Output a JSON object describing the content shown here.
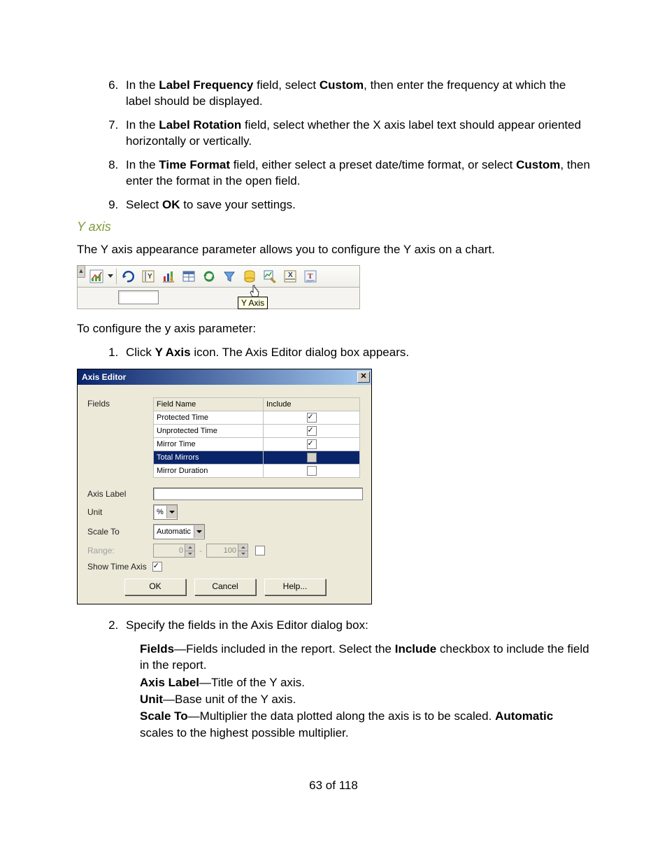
{
  "steps_top": [
    {
      "n": 6,
      "pre": "In the ",
      "b1": "Label Frequency",
      "mid": " field, select ",
      "b2": "Custom",
      "post": ", then enter the frequency at which the label should be displayed."
    },
    {
      "n": 7,
      "pre": "In the ",
      "b1": "Label Rotation",
      "mid": " field, select whether the X axis label text should appear oriented horizontally or vertically.",
      "b2": "",
      "post": ""
    },
    {
      "n": 8,
      "pre": "In the ",
      "b1": "Time Format",
      "mid": " field, either select a preset date/time format, or select ",
      "b2": "Custom",
      "post": ", then enter the format in the open field."
    },
    {
      "n": 9,
      "pre": "Select ",
      "b1": "OK",
      "mid": " to save your settings.",
      "b2": "",
      "post": ""
    }
  ],
  "heading_yaxis": "Y axis",
  "para_yaxis_intro": "The Y axis appearance parameter allows you to configure the Y axis on a chart.",
  "toolbar": {
    "tooltip": "Y Axis"
  },
  "para_configure": "To configure the y axis parameter:",
  "step1": {
    "pre": "Click ",
    "b": "Y Axis",
    "post": " icon. The Axis Editor dialog box appears."
  },
  "dialog": {
    "title": "Axis Editor",
    "fields_label": "Fields",
    "col_fieldname": "Field Name",
    "col_include": "Include",
    "rows": [
      {
        "name": "Protected Time",
        "checked": true,
        "disabled": false,
        "selected": false
      },
      {
        "name": "Unprotected Time",
        "checked": true,
        "disabled": false,
        "selected": false
      },
      {
        "name": "Mirror Time",
        "checked": true,
        "disabled": false,
        "selected": false
      },
      {
        "name": "Total Mirrors",
        "checked": false,
        "disabled": true,
        "selected": true
      },
      {
        "name": "Mirror Duration",
        "checked": false,
        "disabled": false,
        "selected": false
      }
    ],
    "axis_label_lbl": "Axis Label",
    "unit_lbl": "Unit",
    "unit_value": "%",
    "scaleto_lbl": "Scale To",
    "scaleto_value": "Automatic",
    "range_lbl": "Range:",
    "range_low": "0",
    "range_high": "100",
    "show_time_lbl": "Show Time Axis",
    "show_time_checked": true,
    "btn_ok": "OK",
    "btn_cancel": "Cancel",
    "btn_help": "Help..."
  },
  "step2": "Specify the fields in the Axis Editor dialog box:",
  "defs": {
    "fields_b": "Fields",
    "fields_t": "—Fields included in the report. Select the ",
    "fields_b2": "Include",
    "fields_t2": " checkbox to include the field in the report.",
    "axis_b": "Axis Label",
    "axis_t": "—Title of the Y axis.",
    "unit_b": "Unit",
    "unit_t": "—Base unit of the Y axis.",
    "scale_b": "Scale To",
    "scale_t": "—Multiplier the data plotted along the axis is to be scaled. ",
    "auto_b": "Automatic",
    "auto_t": " scales to the highest possible multiplier."
  },
  "footer": "63 of 118"
}
